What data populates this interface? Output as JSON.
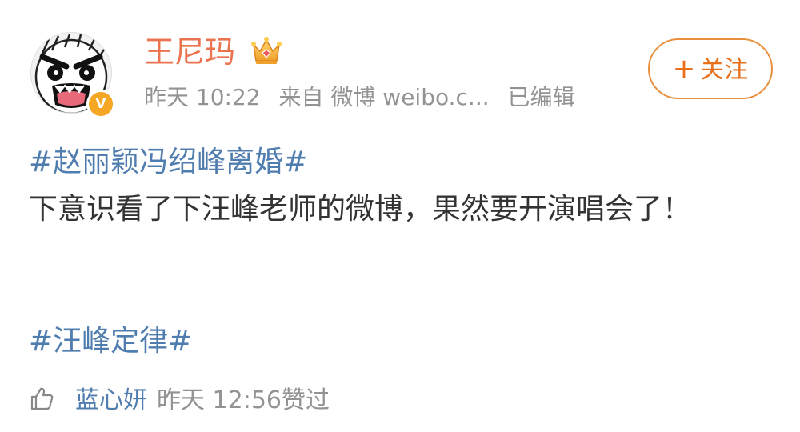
{
  "post": {
    "author": {
      "name": "王尼玛",
      "avatar_icon": "rage-face-avatar",
      "verified_badge": "V",
      "badge_icon": "crown-icon"
    },
    "meta": {
      "time": "昨天 10:22",
      "source": "来自 微博 weibo.c...",
      "edited": "已编辑"
    },
    "follow_button": {
      "plus": "+",
      "label": "关注"
    },
    "hashtag_1": "#赵丽颖冯绍峰离婚#",
    "text": "下意识看了下汪峰老师的微博，果然要开演唱会了！",
    "hashtag_2": "#汪峰定律#"
  },
  "like": {
    "icon": "thumbs-up-icon",
    "liker": "蓝心妍",
    "meta": "昨天 12:56赞过"
  },
  "colors": {
    "username": "#eb7350",
    "link": "#507daf",
    "meta": "#939393",
    "follow": "#e8701a",
    "verified": "#f5a623"
  }
}
